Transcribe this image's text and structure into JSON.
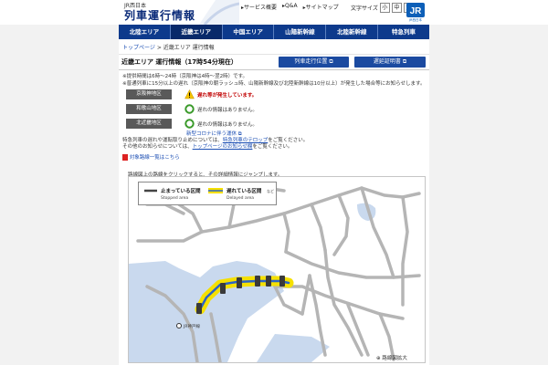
{
  "header": {
    "brand_small": "JR西日本",
    "brand_title": "列車運行情報",
    "links": [
      "サービス概要",
      "Q&A",
      "サイトマップ"
    ],
    "font_size_label": "文字サイズ",
    "font_sizes": [
      "小",
      "中",
      "大"
    ],
    "logo_text": "JR",
    "logo_sub": "JR西日本"
  },
  "nav": {
    "tabs": [
      "北陸エリア",
      "近畿エリア",
      "中国エリア",
      "山陽新幹線",
      "北陸新幹線",
      "特急列車"
    ]
  },
  "breadcrumb": {
    "home": "トップページ",
    "sep": ">",
    "current": "近畿エリア 運行情報"
  },
  "title_bar": {
    "title": "近畿エリア 運行情報（17時54分現在）",
    "button_train_position": "列車走行位置",
    "button_delay_cert": "遅延証明書"
  },
  "notes": {
    "line1": "※提供時間は6時〜24時（京阪神は4時〜翌2時）です。",
    "line2": "※普通列車に15分以上の遅れ（京阪神の朝ラッシュ時、山陽新幹線及び北陸新幹線は10分以上）が発生した場合等にお知らせします。"
  },
  "regions": [
    {
      "name": "京阪神地区",
      "status": "遅れ等が発生しています。",
      "alert": true
    },
    {
      "name": "和歌山地区",
      "status": "遅れの情報はありません。",
      "alert": false
    },
    {
      "name": "北近畿地区",
      "status": "遅れの情報はありません。",
      "alert": false
    }
  ],
  "links": {
    "corona": "新型コロナに伴う運休",
    "info_line1_pre": "特急列車の遅れや運転取り止めについては、",
    "info_line1_link": "特急列車のテロップ",
    "info_line1_post": "をご覧ください。",
    "info_line2_pre": "その他のお知らせについては、",
    "info_line2_link": "トップページのお知らせ欄",
    "info_line2_post": "をご覧ください。",
    "pdf": "対象路線一覧はこちら"
  },
  "map": {
    "instruction": "路線図上の路線をクリックすると、その詳細情報にジャンプします。",
    "legend_stopped_jp": "止まっている区間",
    "legend_stopped_en": "Stopped area",
    "legend_delayed_jp": "遅れている区間",
    "legend_delayed_en": "Delayed area",
    "legend_delayed_suffix": "など",
    "station_label": "JR神戸線",
    "footer": "路線図拡大"
  },
  "colors": {
    "brand_blue": "#0d3a8c",
    "alert_red": "#c00000",
    "ok_green": "#3a9a2a",
    "delay_yellow": "#f5e000",
    "line_gray": "#b5b5b5",
    "sea_blue": "#c9d9ee"
  }
}
